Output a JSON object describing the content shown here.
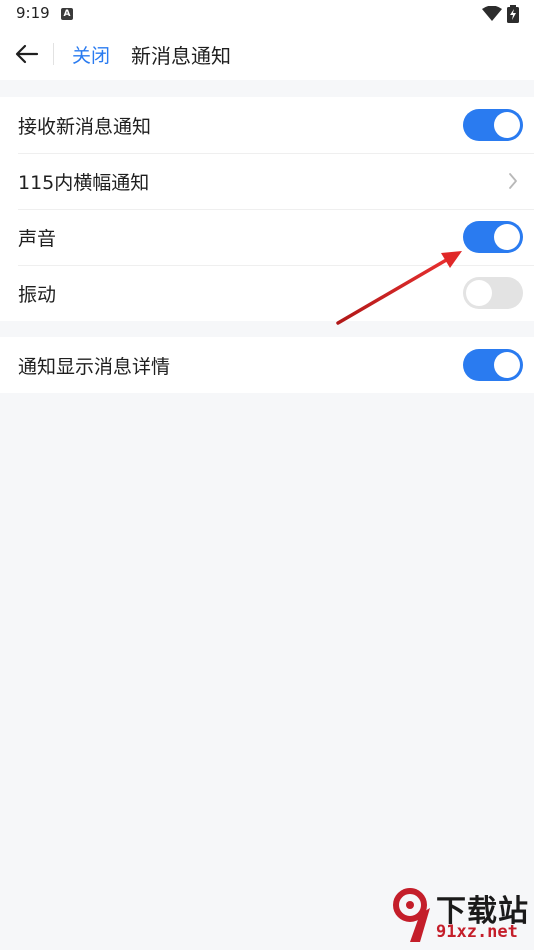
{
  "status_bar": {
    "time": "9:19",
    "notification_glyph": "A",
    "icons": [
      "wifi-icon",
      "battery-icon"
    ]
  },
  "header": {
    "back_icon": "arrow-left-icon",
    "close_label": "关闭",
    "title": "新消息通知"
  },
  "groups": [
    {
      "rows": [
        {
          "label": "接收新消息通知",
          "control": "toggle",
          "on": true
        },
        {
          "label": "115内横幅通知",
          "control": "chevron"
        },
        {
          "label": "声音",
          "control": "toggle",
          "on": true
        },
        {
          "label": "振动",
          "control": "toggle",
          "on": false
        }
      ]
    },
    {
      "rows": [
        {
          "label": "通知显示消息详情",
          "control": "toggle",
          "on": true
        }
      ]
    }
  ],
  "watermark": {
    "title": "下载站",
    "domain": "91xz.net"
  },
  "colors": {
    "accent": "#2a7bf0",
    "toggle_off": "#e3e3e3",
    "background": "#f6f7f9",
    "annotation_arrow": "#d62020",
    "watermark_red": "#c41e2a"
  }
}
